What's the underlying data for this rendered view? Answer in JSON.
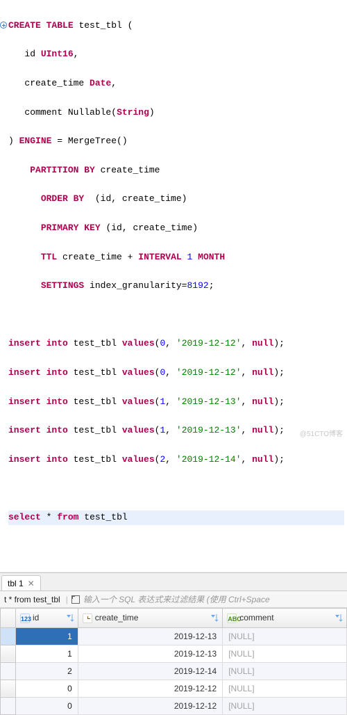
{
  "code": {
    "create_kw": "CREATE TABLE",
    "table_name": "test_tbl",
    "col_id": "id",
    "type_uint16": "UInt16",
    "col_create_time": "create_time",
    "type_date": "Date",
    "col_comment": "comment",
    "nullable_kw": "Nullable",
    "type_string": "String",
    "engine_kw": "ENGINE",
    "engine_name": "MergeTree",
    "partition_kw": "PARTITION BY",
    "partition_expr": "create_time",
    "orderby_kw": "ORDER BY",
    "orderby_expr": "(id, create_time)",
    "pk_kw": "PRIMARY KEY",
    "pk_expr": "(id, create_time)",
    "ttl_kw": "TTL",
    "ttl_left": "create_time",
    "ttl_plus": "+",
    "interval_kw": "INTERVAL",
    "ttl_num": "1",
    "month_kw": "MONTH",
    "settings_kw": "SETTINGS",
    "settings_key": "index_granularity",
    "settings_val": "8192",
    "insert_kw": "insert into",
    "values_kw": "values",
    "null_kw": "null",
    "inserts": [
      {
        "id": "0",
        "date": "'2019-12-12'"
      },
      {
        "id": "0",
        "date": "'2019-12-12'"
      },
      {
        "id": "1",
        "date": "'2019-12-13'"
      },
      {
        "id": "1",
        "date": "'2019-12-13'"
      },
      {
        "id": "2",
        "date": "'2019-12-14'"
      }
    ],
    "select_kw": "select",
    "star": "*",
    "from_kw": "from",
    "select_table": "test_tbl"
  },
  "tab": {
    "label": "tbl 1",
    "close": "✕"
  },
  "toolbar": {
    "query": "t * from test_tbl",
    "hint": "输入一个 SQL 表达式来过滤结果 (使用 Ctrl+Space"
  },
  "grid": {
    "headers": {
      "id_prefix": "123",
      "id": "id",
      "create_time_icon": "◷",
      "create_time": "create_time",
      "comment_prefix": "ABC",
      "comment": "comment"
    },
    "rows": [
      {
        "id": "1",
        "create_time": "2019-12-13",
        "comment": "[NULL]",
        "selected": true
      },
      {
        "id": "1",
        "create_time": "2019-12-13",
        "comment": "[NULL]",
        "selected": false
      },
      {
        "id": "2",
        "create_time": "2019-12-14",
        "comment": "[NULL]",
        "selected": false
      },
      {
        "id": "0",
        "create_time": "2019-12-12",
        "comment": "[NULL]",
        "selected": false
      },
      {
        "id": "0",
        "create_time": "2019-12-12",
        "comment": "[NULL]",
        "selected": false
      }
    ]
  },
  "watermark": "@51CTO博客"
}
